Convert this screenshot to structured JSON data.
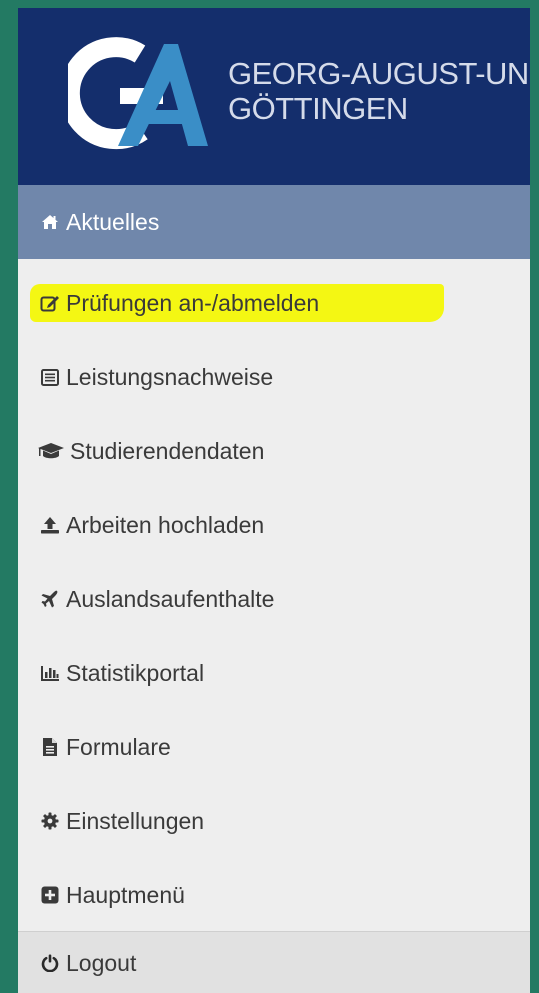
{
  "header": {
    "line1": "GEORG-AUGUST-UN",
    "line2": "GÖTTINGEN"
  },
  "nav": {
    "active": {
      "label": "Aktuelles",
      "icon": "home-icon"
    },
    "items": [
      {
        "label": "Prüfungen an-/abmelden",
        "icon": "edit-icon",
        "highlighted": true
      },
      {
        "label": "Leistungsnachweise",
        "icon": "list-alt-icon"
      },
      {
        "label": "Studierendendaten",
        "icon": "graduation-cap-icon"
      },
      {
        "label": "Arbeiten hochladen",
        "icon": "upload-icon"
      },
      {
        "label": "Auslandsaufenthalte",
        "icon": "plane-icon"
      },
      {
        "label": "Statistikportal",
        "icon": "bar-chart-icon"
      },
      {
        "label": "Formulare",
        "icon": "file-icon"
      },
      {
        "label": "Einstellungen",
        "icon": "gear-icon"
      },
      {
        "label": "Hauptmenü",
        "icon": "plus-square-icon"
      }
    ],
    "logout": {
      "label": "Logout",
      "icon": "power-icon"
    }
  },
  "colors": {
    "background": "#237a63",
    "header": "#142e6c",
    "active_item": "#7087ab",
    "highlight": "#f4f700",
    "text": "#3a3a3a"
  }
}
